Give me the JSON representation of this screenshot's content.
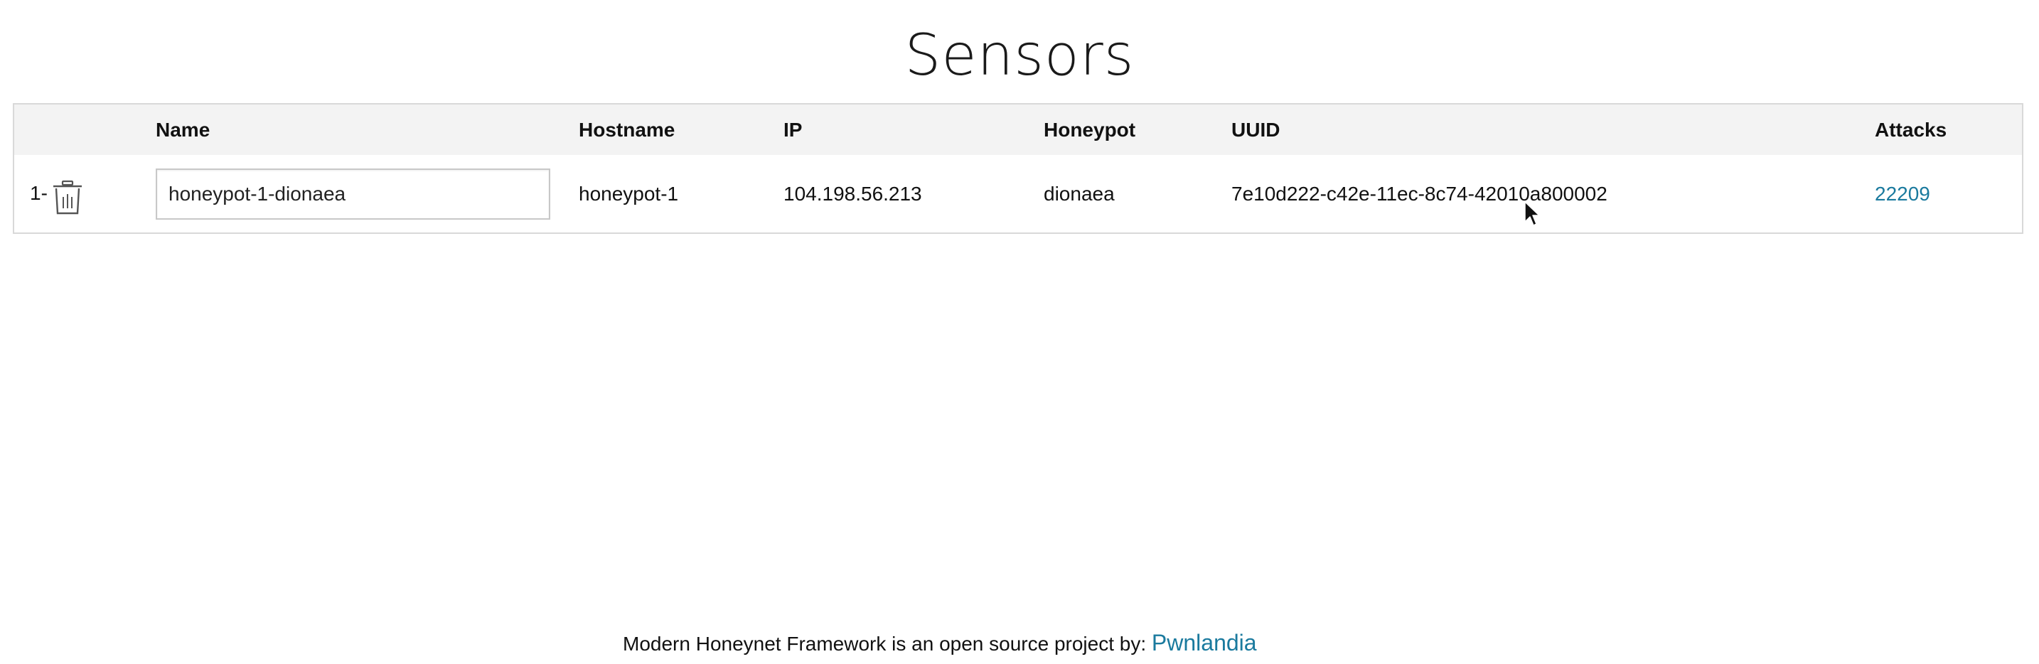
{
  "page": {
    "title": "Sensors"
  },
  "table": {
    "headers": {
      "index": "",
      "name": "Name",
      "hostname": "Hostname",
      "ip": "IP",
      "honeypot": "Honeypot",
      "uuid": "UUID",
      "attacks": "Attacks"
    },
    "rows": [
      {
        "index": "1-",
        "delete_icon": "trash-icon",
        "name_value": "honeypot-1-dionaea",
        "hostname": "honeypot-1",
        "ip": "104.198.56.213",
        "honeypot": "dionaea",
        "uuid": "7e10d222-c42e-11ec-8c74-42010a800002",
        "attacks": "22209"
      }
    ]
  },
  "footer": {
    "text": "Modern Honeynet Framework is an open source project by: ",
    "link_label": "Pwnlandia"
  },
  "colors": {
    "link": "#1a7a9e",
    "header_bg": "#f3f3f3",
    "border": "#d9d9d9"
  }
}
